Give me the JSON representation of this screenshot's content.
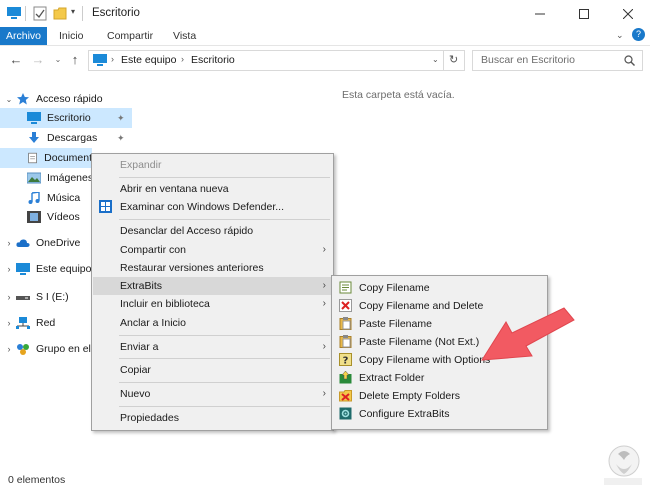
{
  "window": {
    "title": "Escritorio"
  },
  "ribbon": {
    "tabs": [
      "Archivo",
      "Inicio",
      "Compartir",
      "Vista"
    ]
  },
  "address": {
    "segments": [
      "Este equipo",
      "Escritorio"
    ]
  },
  "search": {
    "placeholder": "Buscar en Escritorio"
  },
  "sidebar": {
    "items": [
      {
        "label": "Acceso rápido"
      },
      {
        "label": "Escritorio"
      },
      {
        "label": "Descargas"
      },
      {
        "label": "Document"
      },
      {
        "label": "Imágenes"
      },
      {
        "label": "Música"
      },
      {
        "label": "Vídeos"
      },
      {
        "label": "OneDrive"
      },
      {
        "label": "Este equipo"
      },
      {
        "label": "S I (E:)"
      },
      {
        "label": "Red"
      },
      {
        "label": "Grupo en el"
      }
    ]
  },
  "main": {
    "empty_message": "Esta carpeta está vacía."
  },
  "context_menu": {
    "items": [
      {
        "label": "Expandir"
      },
      {
        "label": "Abrir en ventana nueva"
      },
      {
        "label": "Examinar con Windows Defender..."
      },
      {
        "label": "Desanclar del Acceso rápido"
      },
      {
        "label": "Compartir con"
      },
      {
        "label": "Restaurar versiones anteriores"
      },
      {
        "label": "ExtraBits"
      },
      {
        "label": "Incluir en biblioteca"
      },
      {
        "label": "Anclar a Inicio"
      },
      {
        "label": "Enviar a"
      },
      {
        "label": "Copiar"
      },
      {
        "label": "Nuevo"
      },
      {
        "label": "Propiedades"
      }
    ]
  },
  "submenu": {
    "items": [
      {
        "label": "Copy Filename"
      },
      {
        "label": "Copy Filename and Delete"
      },
      {
        "label": "Paste Filename"
      },
      {
        "label": "Paste Filename (Not Ext.)"
      },
      {
        "label": "Copy Filename with Options"
      },
      {
        "label": "Extract Folder"
      },
      {
        "label": "Delete Empty Folders"
      },
      {
        "label": "Configure ExtraBits"
      }
    ]
  },
  "status": {
    "count": "0 elementos"
  },
  "colors": {
    "accent": "#1979ca",
    "selection": "#cce8ff",
    "arrow": "#f0505a",
    "menu_bg": "#f0f0f0"
  }
}
